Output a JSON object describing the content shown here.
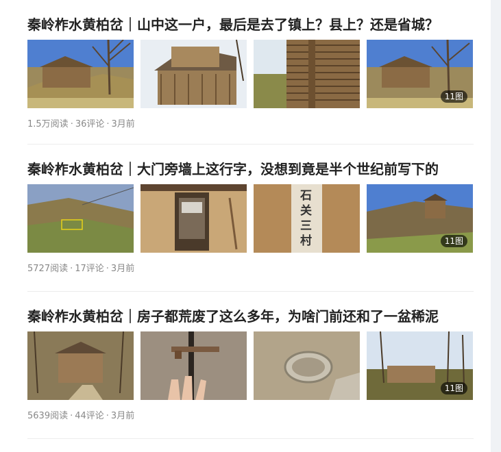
{
  "articles": [
    {
      "title": "秦岭柞水黄柏岔｜山中这一户，最后是去了镇上？县上？还是省城？",
      "image_count": "11图",
      "reads": "1.5万阅读",
      "comments": "36评论",
      "time": "3月前"
    },
    {
      "title": "秦岭柞水黄柏岔｜大门旁墙上这行字，没想到竟是半个世纪前写下的",
      "image_count": "11图",
      "reads": "5727阅读",
      "comments": "17评论",
      "time": "3月前",
      "wall_text": "石关三村"
    },
    {
      "title": "秦岭柞水黄柏岔｜房子都荒废了这么多年，为啥门前还和了一盆稀泥",
      "image_count": "11图",
      "reads": "5639阅读",
      "comments": "44评论",
      "time": "3月前"
    }
  ],
  "separator": "·",
  "colors": {
    "title": "#222222",
    "meta": "#888888",
    "divider": "#ececec",
    "gutter": "#f0f2f5"
  }
}
